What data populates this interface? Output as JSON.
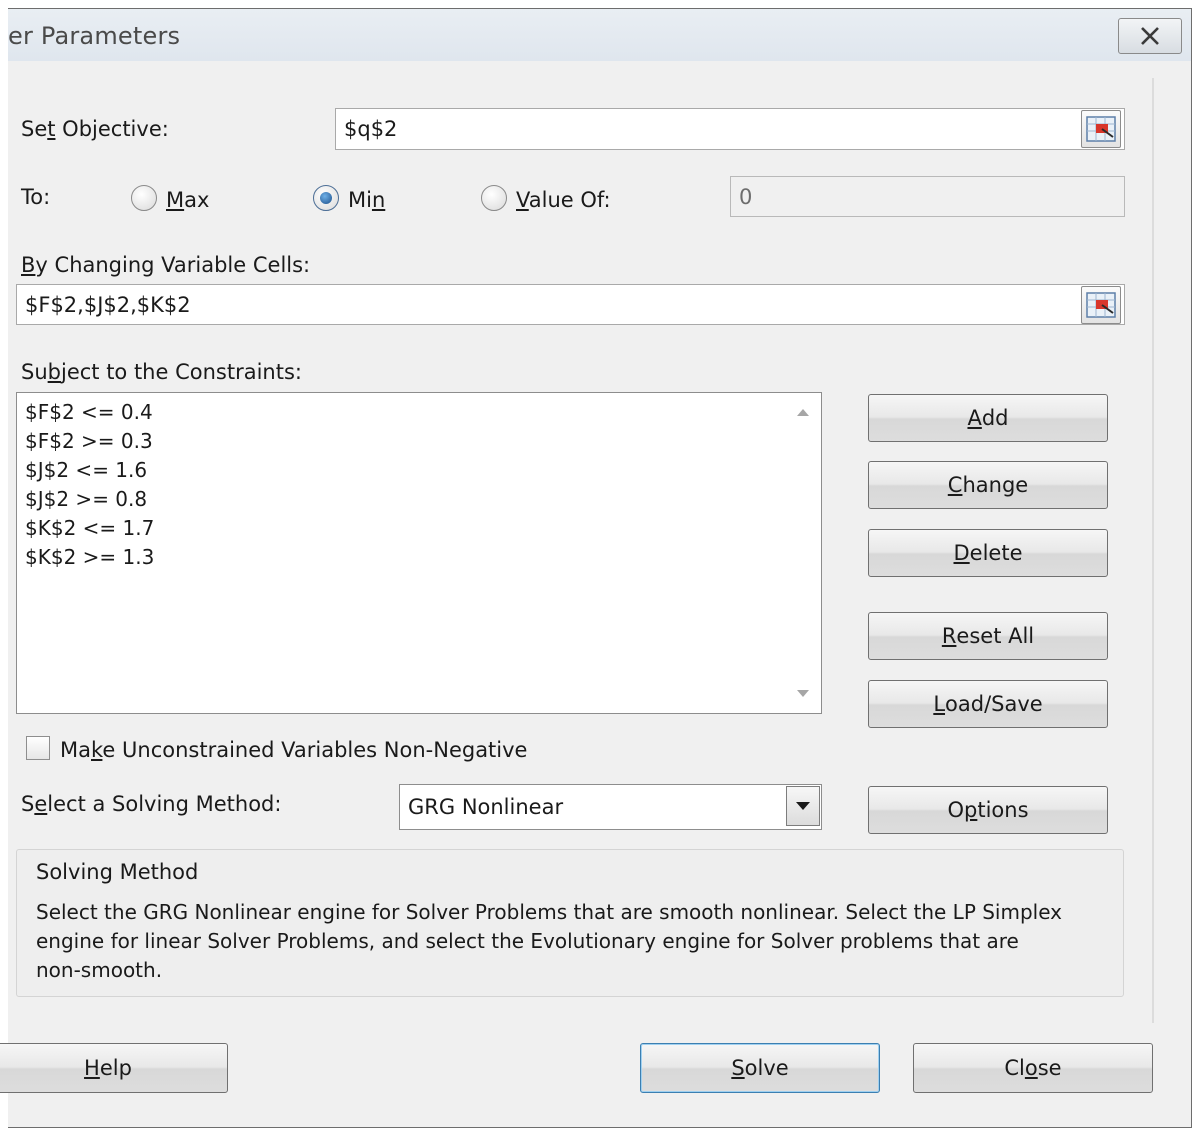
{
  "window": {
    "title": "er Parameters",
    "close_glyph": "✕"
  },
  "objective": {
    "label_pre": "Se",
    "label_u": "t",
    "label_post": " Objective:",
    "value": "$q$2"
  },
  "to": {
    "label": "To:",
    "options": [
      {
        "pre": "",
        "u": "M",
        "post": "ax",
        "selected": false
      },
      {
        "pre": "Mi",
        "u": "n",
        "post": "",
        "selected": true
      },
      {
        "pre": "",
        "u": "V",
        "post": "alue Of:",
        "selected": false
      }
    ],
    "value_of": "0"
  },
  "variables": {
    "label_u": "B",
    "label_post": "y Changing Variable Cells:",
    "value": "$F$2,$J$2,$K$2"
  },
  "constraints": {
    "label_pre": "Su",
    "label_u": "b",
    "label_post": "ject to the Constraints:",
    "items": [
      "$F$2 <= 0.4",
      "$F$2 >= 0.3",
      "$J$2 <= 1.6",
      "$J$2 >= 0.8",
      "$K$2 <= 1.7",
      "$K$2 >= 1.3"
    ]
  },
  "buttons": {
    "add": {
      "pre": "",
      "u": "A",
      "post": "dd"
    },
    "change": {
      "pre": "",
      "u": "C",
      "post": "hange"
    },
    "delete": {
      "pre": "",
      "u": "D",
      "post": "elete"
    },
    "reset_all": {
      "pre": "",
      "u": "R",
      "post": "eset All"
    },
    "load_save": {
      "pre": "",
      "u": "L",
      "post": "oad/Save"
    },
    "options": {
      "pre": "O",
      "u": "p",
      "post": "tions"
    },
    "help": {
      "pre": "",
      "u": "H",
      "post": "elp"
    },
    "solve": {
      "pre": "",
      "u": "S",
      "post": "olve"
    },
    "close": {
      "pre": "Cl",
      "u": "o",
      "post": "se"
    }
  },
  "nonnegative": {
    "checked": false,
    "label_pre": "Ma",
    "label_u": "k",
    "label_post": "e Unconstrained Variables Non-Negative"
  },
  "method": {
    "label_pre": "S",
    "label_u": "e",
    "label_post": "lect a Solving Method:",
    "selected": "GRG Nonlinear"
  },
  "solving_method_box": {
    "heading": "Solving Method",
    "lines": [
      "Select the GRG Nonlinear engine for Solver Problems that are smooth nonlinear. Select the LP Simplex",
      "engine for linear Solver Problems, and select the Evolutionary engine for Solver problems that are",
      "non-smooth."
    ]
  },
  "icons": {
    "range_selector": "range-select-icon",
    "dropdown": "chevron-down-icon",
    "scroll_up": "scroll-up-icon",
    "scroll_down": "scroll-down-icon",
    "close": "close-icon"
  },
  "colors": {
    "dialog_bg": "#f0f0f0",
    "title_bar": "#dfe6ee",
    "radio_selected": "#1b4f8a",
    "default_button_border": "#3c7fb1"
  }
}
